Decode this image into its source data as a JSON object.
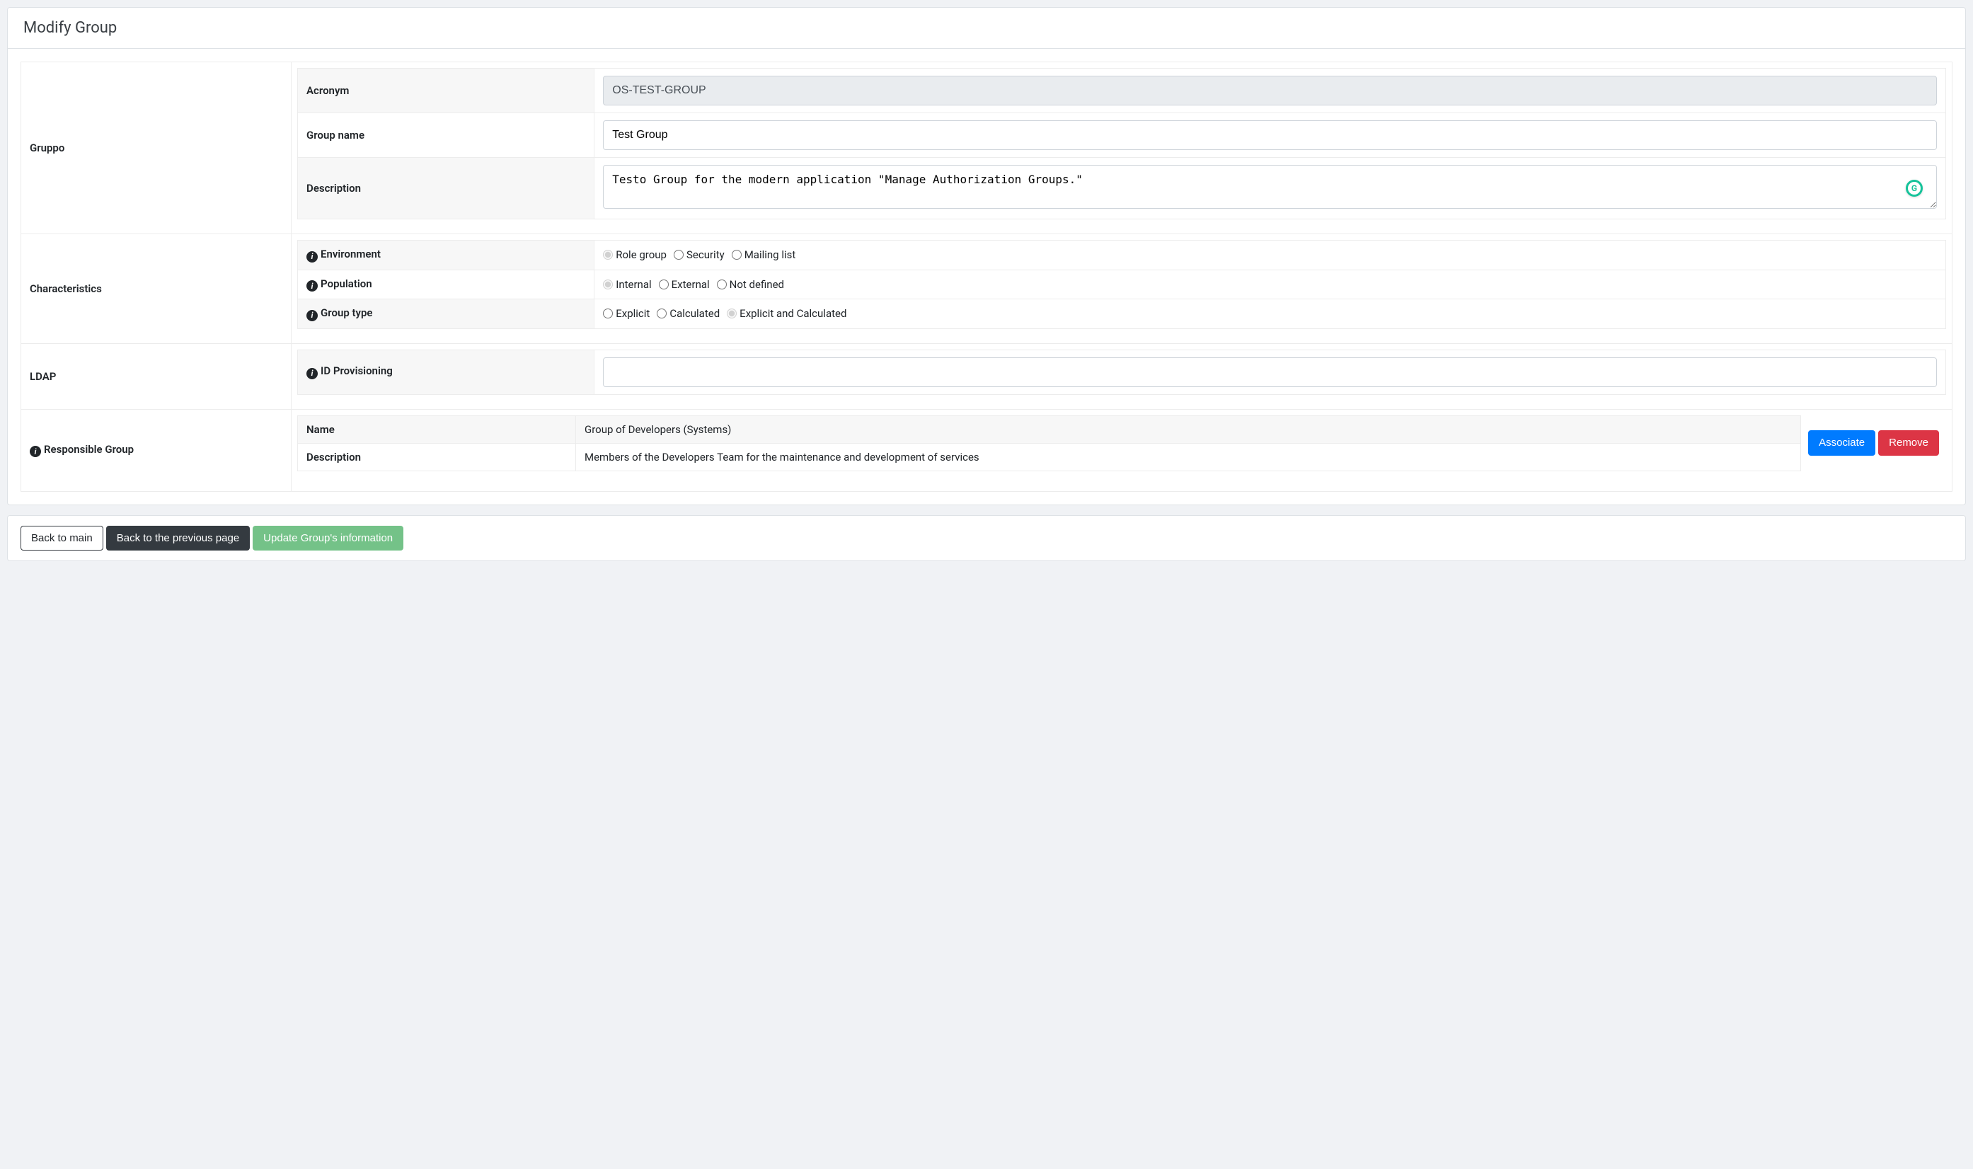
{
  "header": {
    "title": "Modify Group"
  },
  "sections": {
    "gruppo": {
      "label": "Gruppo",
      "fields": {
        "acronym": {
          "label": "Acronym",
          "value": "OS-TEST-GROUP"
        },
        "groupname": {
          "label": "Group name",
          "value": "Test Group"
        },
        "description": {
          "label": "Description",
          "value": "Testo Group for the modern application \"Manage Authorization Groups.\""
        }
      }
    },
    "characteristics": {
      "label": "Characteristics",
      "fields": {
        "environment": {
          "label": "Environment",
          "options": [
            "Role group",
            "Security",
            "Mailing list"
          ],
          "selected": "Role group"
        },
        "population": {
          "label": "Population",
          "options": [
            "Internal",
            "External",
            "Not defined"
          ],
          "selected": "Internal"
        },
        "grouptype": {
          "label": "Group type",
          "options": [
            "Explicit",
            "Calculated",
            "Explicit and Calculated"
          ],
          "selected": "Explicit and Calculated"
        }
      }
    },
    "ldap": {
      "label": "LDAP",
      "fields": {
        "idprov": {
          "label": "ID Provisioning",
          "value": ""
        }
      }
    },
    "responsible": {
      "label": "Responsible Group",
      "name_label": "Name",
      "name_value": "Group of Developers (Systems)",
      "desc_label": "Description",
      "desc_value": "Members of the Developers Team for the maintenance and development of services",
      "associate_btn": "Associate",
      "remove_btn": "Remove"
    }
  },
  "footer": {
    "back_main": "Back to main",
    "back_prev": "Back to the previous page",
    "update": "Update Group's information"
  }
}
